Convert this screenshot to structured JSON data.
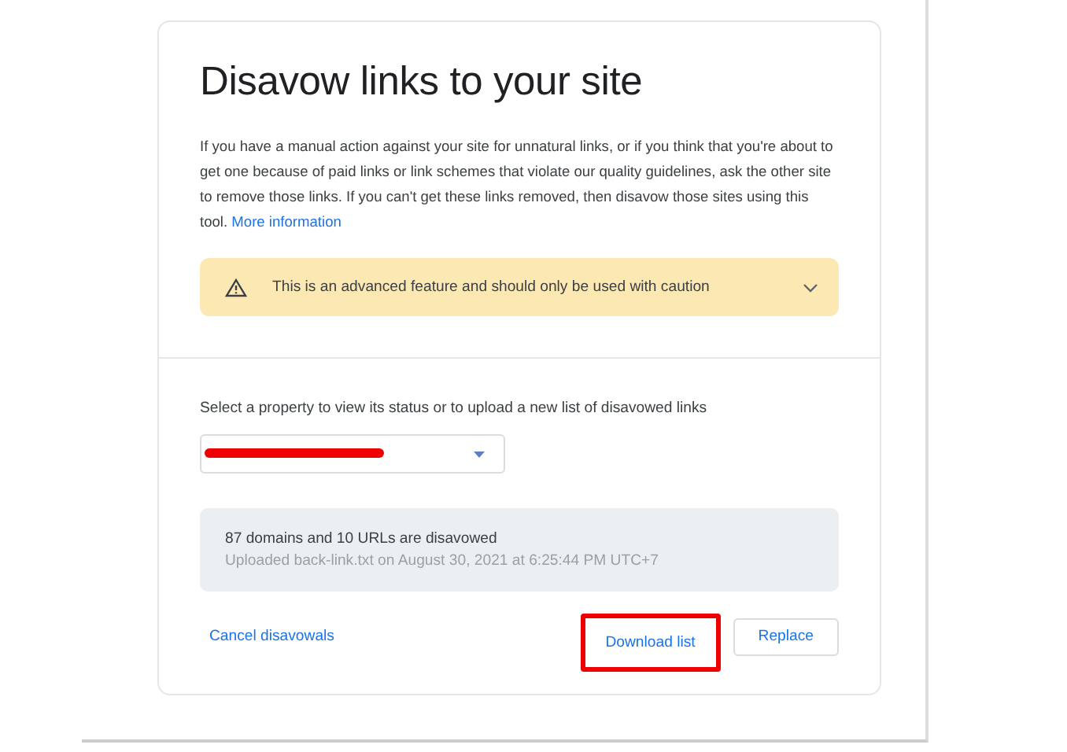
{
  "title": "Disavow links to your site",
  "intro": {
    "text": "If you have a manual action against your site for unnatural links, or if you think that you're about to get one because of paid links or link schemes that violate our quality guidelines, ask the other site to remove those links. If you can't get these links removed, then disavow those sites using this tool.",
    "link": "More information"
  },
  "warning": {
    "text": "This is an advanced feature and should only be used with caution",
    "expanded": false
  },
  "property_label": "Select a property to view its status or to upload a new list of disavowed links",
  "property_select": {
    "redacted": true
  },
  "status": {
    "summary": "87 domains and 10 URLs are disavowed",
    "detail": "Uploaded back-link.txt on August 30, 2021 at 6:25:44 PM UTC+7"
  },
  "actions": [
    {
      "label": "Cancel disavowals",
      "kind": "link",
      "highlighted": false
    },
    {
      "label": "Download list",
      "kind": "text",
      "highlighted": true
    },
    {
      "label": "Replace",
      "kind": "outlined",
      "highlighted": false
    }
  ]
}
